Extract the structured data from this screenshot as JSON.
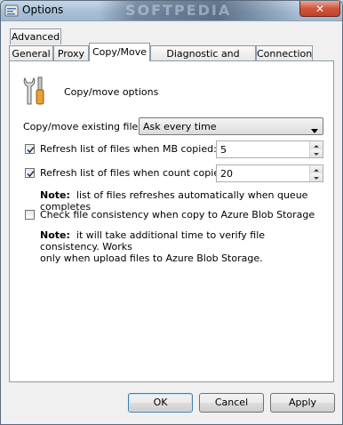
{
  "window": {
    "title": "Options",
    "watermark": "SOFTPEDIA",
    "close_icon": "close-icon"
  },
  "tabs": {
    "row_top": [
      {
        "label": "Advanced"
      }
    ],
    "row_bottom": [
      {
        "label": "General"
      },
      {
        "label": "Proxy"
      },
      {
        "label": "Copy/Move",
        "active": true
      },
      {
        "label": "Diagnostic and logging"
      },
      {
        "label": "Connection"
      }
    ]
  },
  "panel": {
    "header": "Copy/move options",
    "existing_files": {
      "label": "Copy/move existing files:",
      "value": "Ask every time"
    },
    "refresh_mb": {
      "label": "Refresh list of files when MB copied:",
      "checked": true,
      "value": "5"
    },
    "refresh_count": {
      "label": "Refresh list of files when count copied:",
      "checked": true,
      "value": "20"
    },
    "note1": {
      "prefix": "Note:",
      "text": "list of files refreshes automatically when queue completes"
    },
    "consistency": {
      "label": "Check file consistency when copy to Azure Blob Storage",
      "checked": false
    },
    "note2": {
      "prefix": "Note:",
      "line1": "it will take additional time to verify file consistency. Works",
      "line2": "only when upload files to Azure Blob Storage."
    }
  },
  "buttons": {
    "ok": "OK",
    "cancel": "Cancel",
    "apply": "Apply"
  }
}
